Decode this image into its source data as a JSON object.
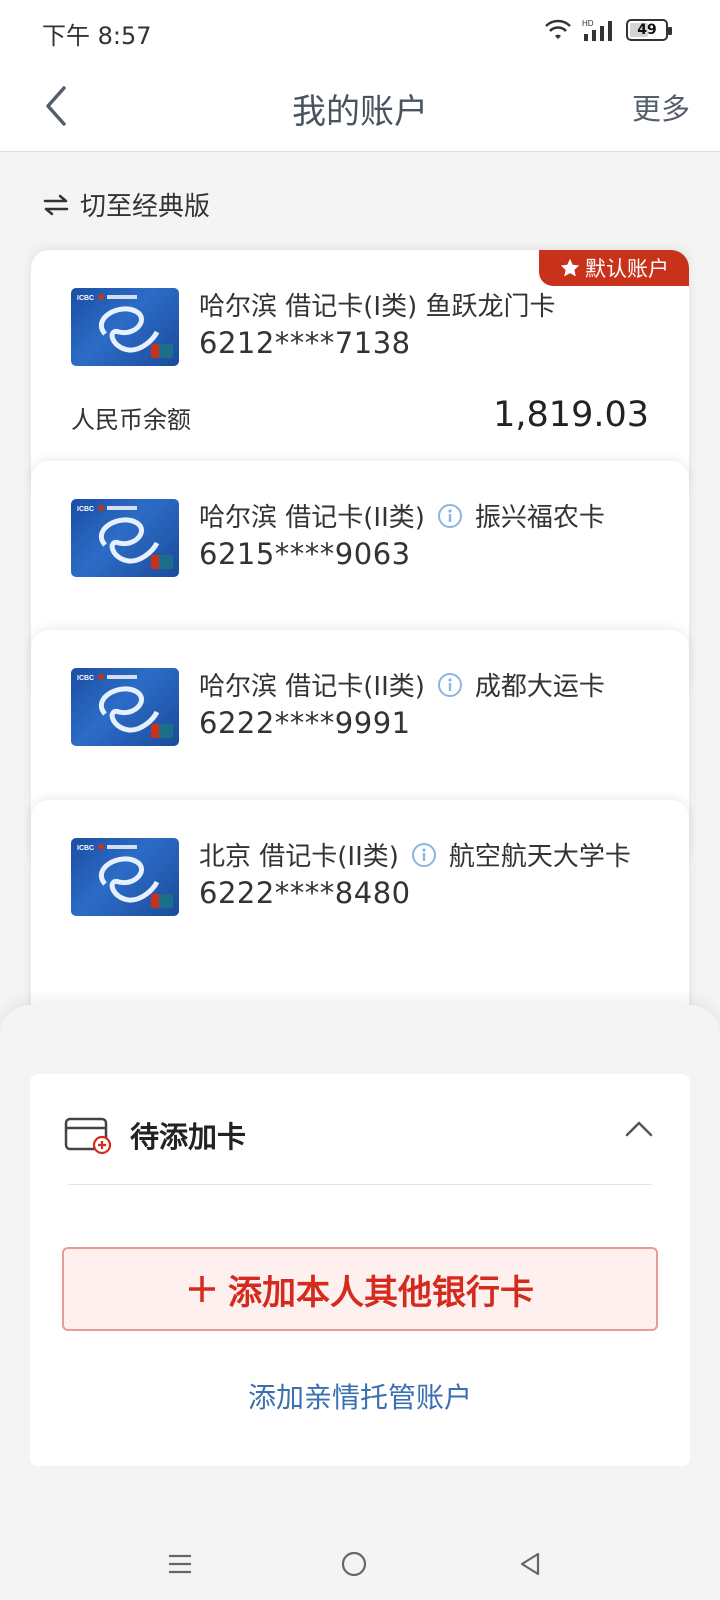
{
  "status_bar": {
    "time": "下午 8:57",
    "battery": "49",
    "network_label": "HD"
  },
  "header": {
    "title": "我的账户",
    "more": "更多"
  },
  "switch": {
    "label": "切至经典版"
  },
  "accounts": [
    {
      "name": "哈尔滨 借记卡(I类) 鱼跃龙门卡",
      "number": "6212****7138",
      "default_badge": "默认账户",
      "balance_label": "人民币余额",
      "balance": "1,819.03"
    },
    {
      "name_prefix": "哈尔滨 借记卡(II类)",
      "name_suffix": "振兴福农卡",
      "number": "6215****9063"
    },
    {
      "name_prefix": "哈尔滨 借记卡(II类)",
      "name_suffix": "成都大运卡",
      "number": "6222****9991"
    },
    {
      "name_prefix": "北京 借记卡(II类)",
      "name_suffix": "航空航天大学卡",
      "number": "6222****8480"
    }
  ],
  "pending": {
    "title": "待添加卡",
    "add_card_button": "添加本人其他银行卡",
    "add_family_link": "添加亲情托管账户"
  },
  "colors": {
    "accent_red": "#d42b1d",
    "badge_red": "#c8321a",
    "link_blue": "#3a6fb0",
    "card_blue": "#1b4ea3"
  },
  "icons": [
    "back-arrow-icon",
    "switch-arrows-icon",
    "star-icon",
    "info-icon",
    "card-add-icon",
    "chevron-up-icon",
    "menu-icon",
    "home-icon",
    "back-triangle-icon",
    "wifi-icon",
    "signal-icon",
    "battery-icon"
  ]
}
